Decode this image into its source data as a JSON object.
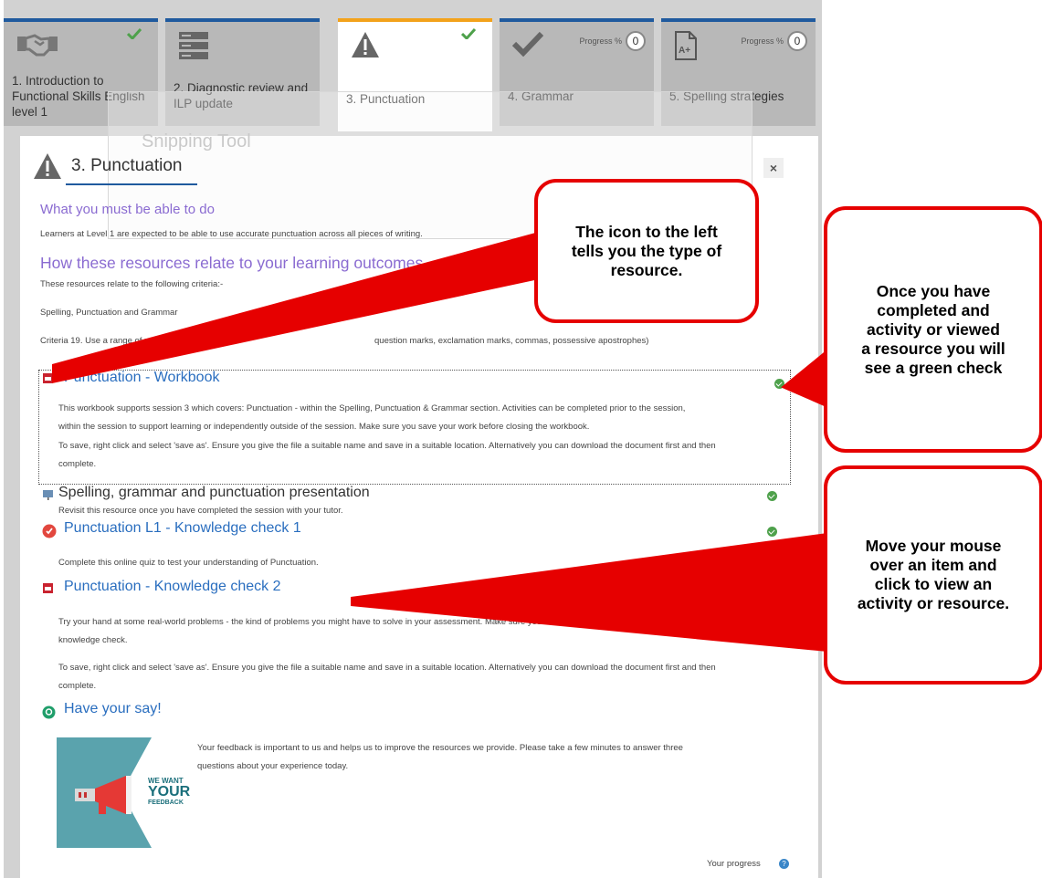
{
  "tiles": [
    {
      "label": "1. Introduction to Functional Skills English level 1",
      "icon": "handshake-icon",
      "status": "complete"
    },
    {
      "label": "2. Diagnostic review and ILP update",
      "icon": "server-icon",
      "status": "none"
    },
    {
      "label": "3. Punctuation",
      "icon": "warning-icon",
      "status": "complete"
    },
    {
      "label": "4. Grammar",
      "icon": "check-mark-icon",
      "progress_label": "Progress %",
      "progress_value": "0"
    },
    {
      "label": "5. Spelling strategies",
      "icon": "grade-document-icon",
      "progress_label": "Progress %",
      "progress_value": "0"
    }
  ],
  "panel": {
    "title": "3. Punctuation",
    "close": "×",
    "ghost_window": "Snipping Tool",
    "heading1": "What you must be able to do",
    "para1": "Learners at Level 1 are expected to be able to use accurate punctuation across all pieces of writing.",
    "heading2": "How these resources relate to your learning outcomes",
    "para2": "These resources relate to the following criteria:-",
    "para3": "Spelling, Punctuation and Grammar",
    "para4a": "Criteria 19. Use a range of punctuation",
    "para4b": "question marks, exclamation marks, commas, possessive apostrophes)",
    "resources": [
      {
        "title": "Punctuation - Workbook",
        "desc1": "This workbook supports session 3 which covers: Punctuation - within the Spelling, Punctuation & Grammar section. Activities can be completed prior to the session,",
        "desc2": "within the session to support learning or independently outside of the session.  Make sure you save your work before closing the workbook.",
        "desc3": "To save, right click and select 'save as'. Ensure you give the file a suitable name and save in a suitable location. Alternatively you can download the document first and then",
        "desc4": "complete."
      },
      {
        "title": "Spelling, grammar and punctuation presentation",
        "desc1": "Revisit this resource once you have completed the session with your tutor."
      },
      {
        "title": "Punctuation L1 - Knowledge check 1",
        "desc1": "Complete this online quiz to test your understanding of Punctuation."
      },
      {
        "title": "Punctuation - Knowledge check 2",
        "desc1": "Try your hand at some real-world problems - the kind of problems you might have to solve in your assessment.  Make sure you save your work before closing the",
        "desc2": "knowledge check.",
        "desc3": "To save, right click and select 'save as'. Ensure you give the file a suitable name and save in a suitable location. Alternatively you can download the document first and then",
        "desc4": "complete."
      },
      {
        "title": "Have your say!",
        "desc1": "Your feedback is important to us and helps us to improve the resources we provide.  Please take a few minutes to answer three",
        "desc2": "questions about your experience today."
      }
    ],
    "feedback_image": {
      "line1": "WE WANT",
      "line2": "YOUR",
      "line3": "FEEDBACK"
    },
    "progress_label": "Your progress"
  },
  "callouts": {
    "icon_type": "The icon to the left tells you the type of resource.",
    "green_check": "Once you have completed and activity or viewed a resource you will see a green check",
    "mouse_over": "Move your mouse over an item and click to view an activity or resource."
  },
  "colors": {
    "accent_blue": "#1f5a9e",
    "active_orange": "#f3a21b",
    "callout_red": "#e60000",
    "check_green": "#4ea14b",
    "heading_purple": "#8a6bd1",
    "link_blue": "#2a6ebf"
  }
}
